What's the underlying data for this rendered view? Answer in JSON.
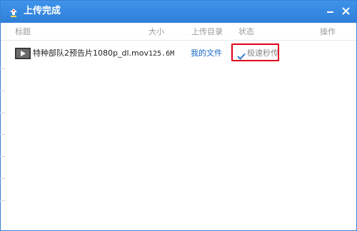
{
  "window": {
    "title": "上传完成",
    "title_icon": "upload-cloud-icon",
    "minimize_icon": "minimize-icon",
    "close_icon": "close-icon",
    "accent": "#3688e3"
  },
  "columns": {
    "title": "标题",
    "size": "大小",
    "upload_dir": "上传目录",
    "status": "状态",
    "actions": "操作"
  },
  "rows": [
    {
      "icon": "video-file-icon",
      "name": "特种部队2预告片1080p_dl.mov",
      "size": "125.6M",
      "directory": "我的文件",
      "status": "极速秒传",
      "status_icon": "checkmark-icon",
      "highlight_color": "#e0001b"
    }
  ]
}
